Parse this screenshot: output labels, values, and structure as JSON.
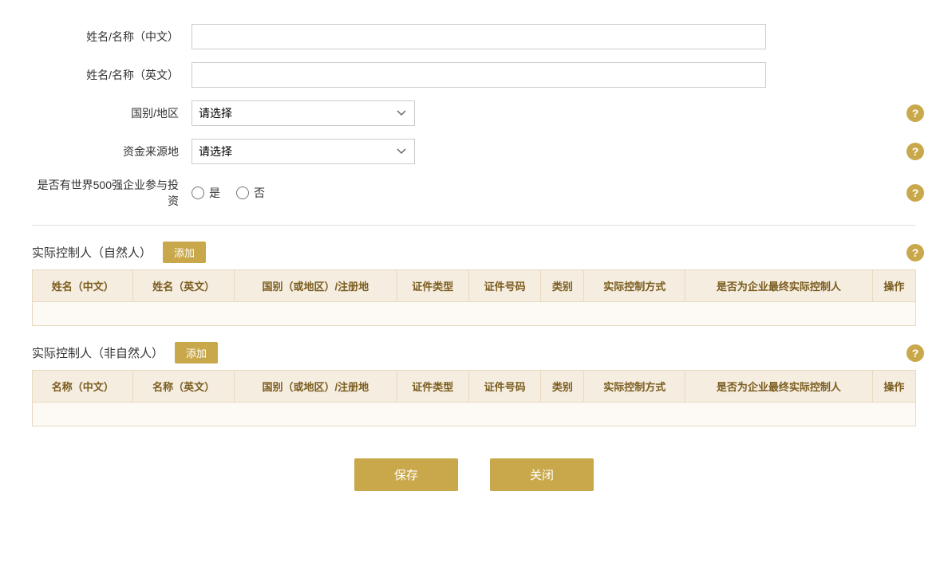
{
  "form": {
    "name_cn_label": "姓名/名称（中文）",
    "name_en_label": "姓名/名称（英文）",
    "country_label": "国别/地区",
    "country_placeholder": "请选择",
    "fund_source_label": "资金来源地",
    "fund_source_placeholder": "请选择",
    "fortune500_label": "是否有世界500强企业参与投资",
    "radio_yes": "是",
    "radio_no": "否",
    "name_cn_value": "",
    "name_en_value": ""
  },
  "natural_person_section": {
    "title": "实际控制人（自然人）",
    "add_btn": "添加",
    "columns": [
      "姓名（中文）",
      "姓名（英文）",
      "国别（或地区）/注册地",
      "证件类型",
      "证件号码",
      "类别",
      "实际控制方式",
      "是否为企业最终实际控制人",
      "操作"
    ]
  },
  "non_natural_person_section": {
    "title": "实际控制人（非自然人）",
    "add_btn": "添加",
    "columns": [
      "名称（中文）",
      "名称（英文）",
      "国别（或地区）/注册地",
      "证件类型",
      "证件号码",
      "类别",
      "实际控制方式",
      "是否为企业最终实际控制人",
      "操作"
    ]
  },
  "footer": {
    "save_btn": "保存",
    "close_btn": "关闭"
  },
  "help_icon": "?",
  "colors": {
    "gold": "#c9a84c",
    "table_header_bg": "#f5ede0",
    "table_header_color": "#7a5c1e",
    "table_border": "#e8d9c0",
    "table_row_bg": "#fdf9f4"
  }
}
